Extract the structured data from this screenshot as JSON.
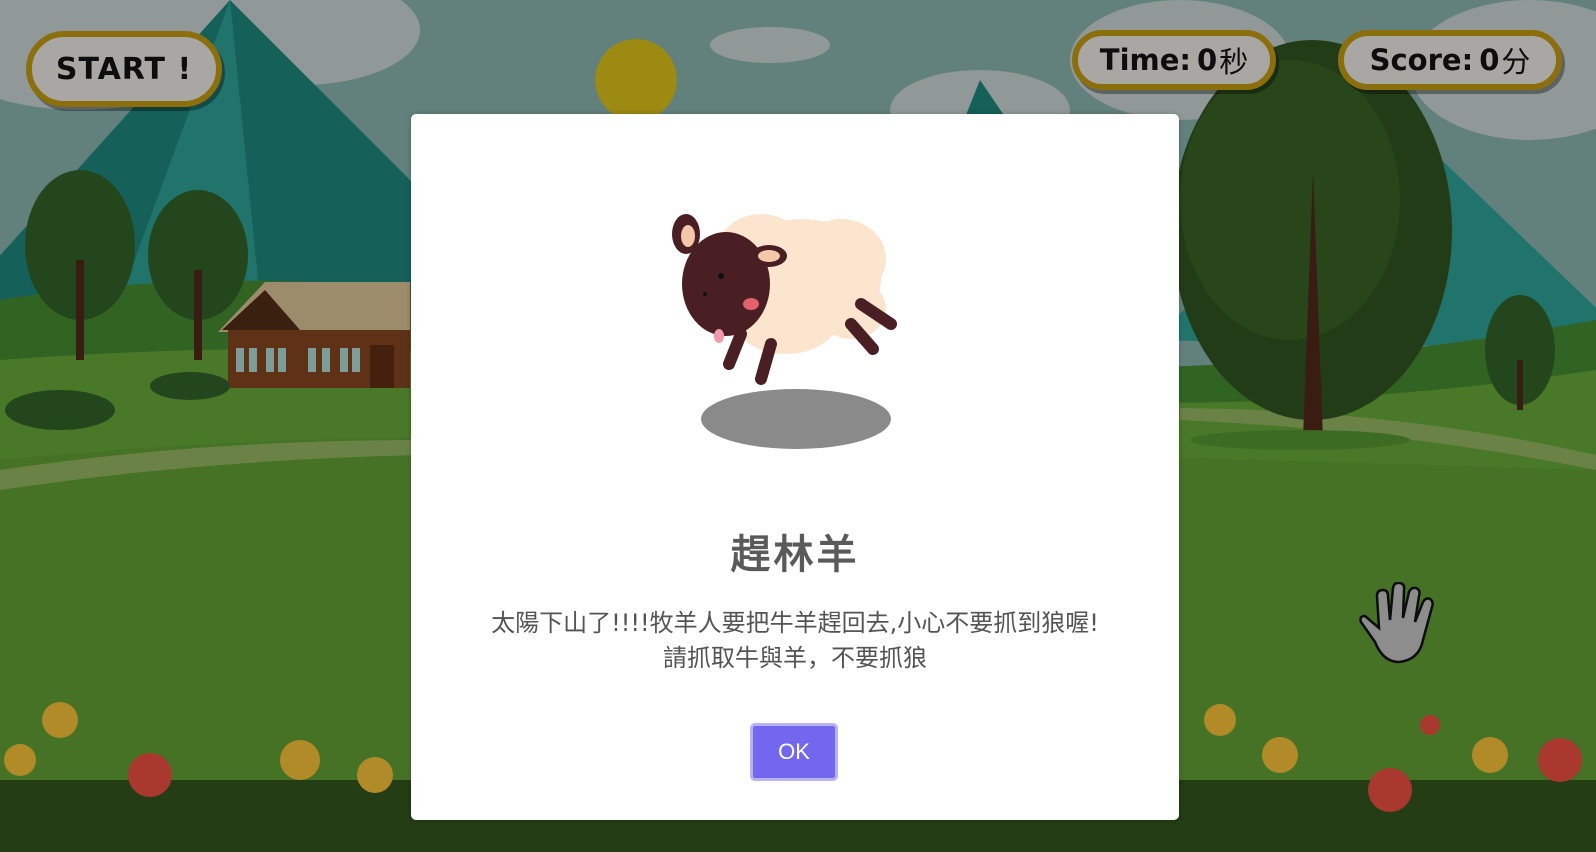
{
  "hud": {
    "start_label": "START !",
    "time_label": "Time:",
    "time_value": "0",
    "time_unit": "秒",
    "score_label": "Score:",
    "score_value": "0",
    "score_unit": "分"
  },
  "modal": {
    "title": "趕林羊",
    "line1": "太陽下山了!!!!牧羊人要把牛羊趕回去,小心不要抓到狼喔!",
    "line2": "請抓取牛與羊，不要抓狼",
    "ok_label": "OK"
  },
  "colors": {
    "pill_border": "#b28f10",
    "pill_fill": "#d9d7d2",
    "ok_button": "#7367f0",
    "grass": "#5e9a34",
    "sky": "#79a7a0"
  },
  "icons": {
    "sheep": "sheep-image",
    "hand": "hand-cursor-icon",
    "sun": "sun-icon"
  }
}
